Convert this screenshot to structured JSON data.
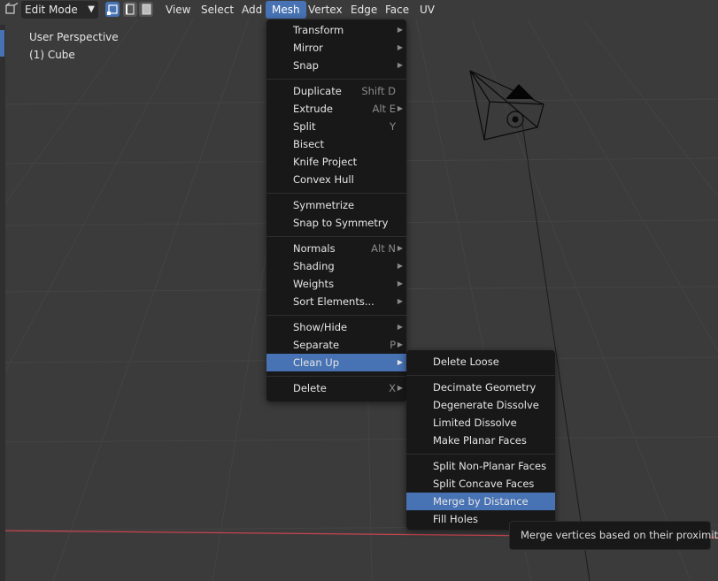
{
  "header": {
    "mode": "Edit Mode",
    "menus": [
      "View",
      "Select",
      "Add",
      "Mesh",
      "Vertex",
      "Edge",
      "Face",
      "UV"
    ],
    "active_menu": "Mesh"
  },
  "viewport": {
    "perspective_label": "User Perspective",
    "object_label": "(1) Cube"
  },
  "mesh_menu": {
    "items": [
      {
        "label": "Transform",
        "shortcut": "",
        "submenu": true
      },
      {
        "label": "Mirror",
        "shortcut": "",
        "submenu": true
      },
      {
        "label": "Snap",
        "shortcut": "",
        "submenu": true
      },
      {
        "label": "Duplicate",
        "shortcut": "Shift D",
        "submenu": false
      },
      {
        "label": "Extrude",
        "shortcut": "Alt E",
        "submenu": true
      },
      {
        "label": "Split",
        "shortcut": "Y",
        "submenu": false
      },
      {
        "label": "Bisect",
        "shortcut": "",
        "submenu": false
      },
      {
        "label": "Knife Project",
        "shortcut": "",
        "submenu": false
      },
      {
        "label": "Convex Hull",
        "shortcut": "",
        "submenu": false
      },
      {
        "label": "Symmetrize",
        "shortcut": "",
        "submenu": false
      },
      {
        "label": "Snap to Symmetry",
        "shortcut": "",
        "submenu": false
      },
      {
        "label": "Normals",
        "shortcut": "Alt N",
        "submenu": true
      },
      {
        "label": "Shading",
        "shortcut": "",
        "submenu": true
      },
      {
        "label": "Weights",
        "shortcut": "",
        "submenu": true
      },
      {
        "label": "Sort Elements...",
        "shortcut": "",
        "submenu": true
      },
      {
        "label": "Show/Hide",
        "shortcut": "",
        "submenu": true
      },
      {
        "label": "Separate",
        "shortcut": "P",
        "submenu": true
      },
      {
        "label": "Clean Up",
        "shortcut": "",
        "submenu": true
      },
      {
        "label": "Delete",
        "shortcut": "X",
        "submenu": true
      }
    ]
  },
  "cleanup_menu": {
    "items": [
      {
        "label": "Delete Loose"
      },
      {
        "label": "Decimate Geometry"
      },
      {
        "label": "Degenerate Dissolve"
      },
      {
        "label": "Limited Dissolve"
      },
      {
        "label": "Make Planar Faces"
      },
      {
        "label": "Split Non-Planar Faces"
      },
      {
        "label": "Split Concave Faces"
      },
      {
        "label": "Merge by Distance"
      },
      {
        "label": "Fill Holes"
      }
    ],
    "highlighted": "Merge by Distance"
  },
  "tooltip": {
    "text": "Merge vertices based on their proximity."
  },
  "colors": {
    "accent": "#4772b3",
    "menu_bg": "#181818",
    "viewport_bg": "#3b3b3b",
    "x_axis": "#c8454f"
  }
}
